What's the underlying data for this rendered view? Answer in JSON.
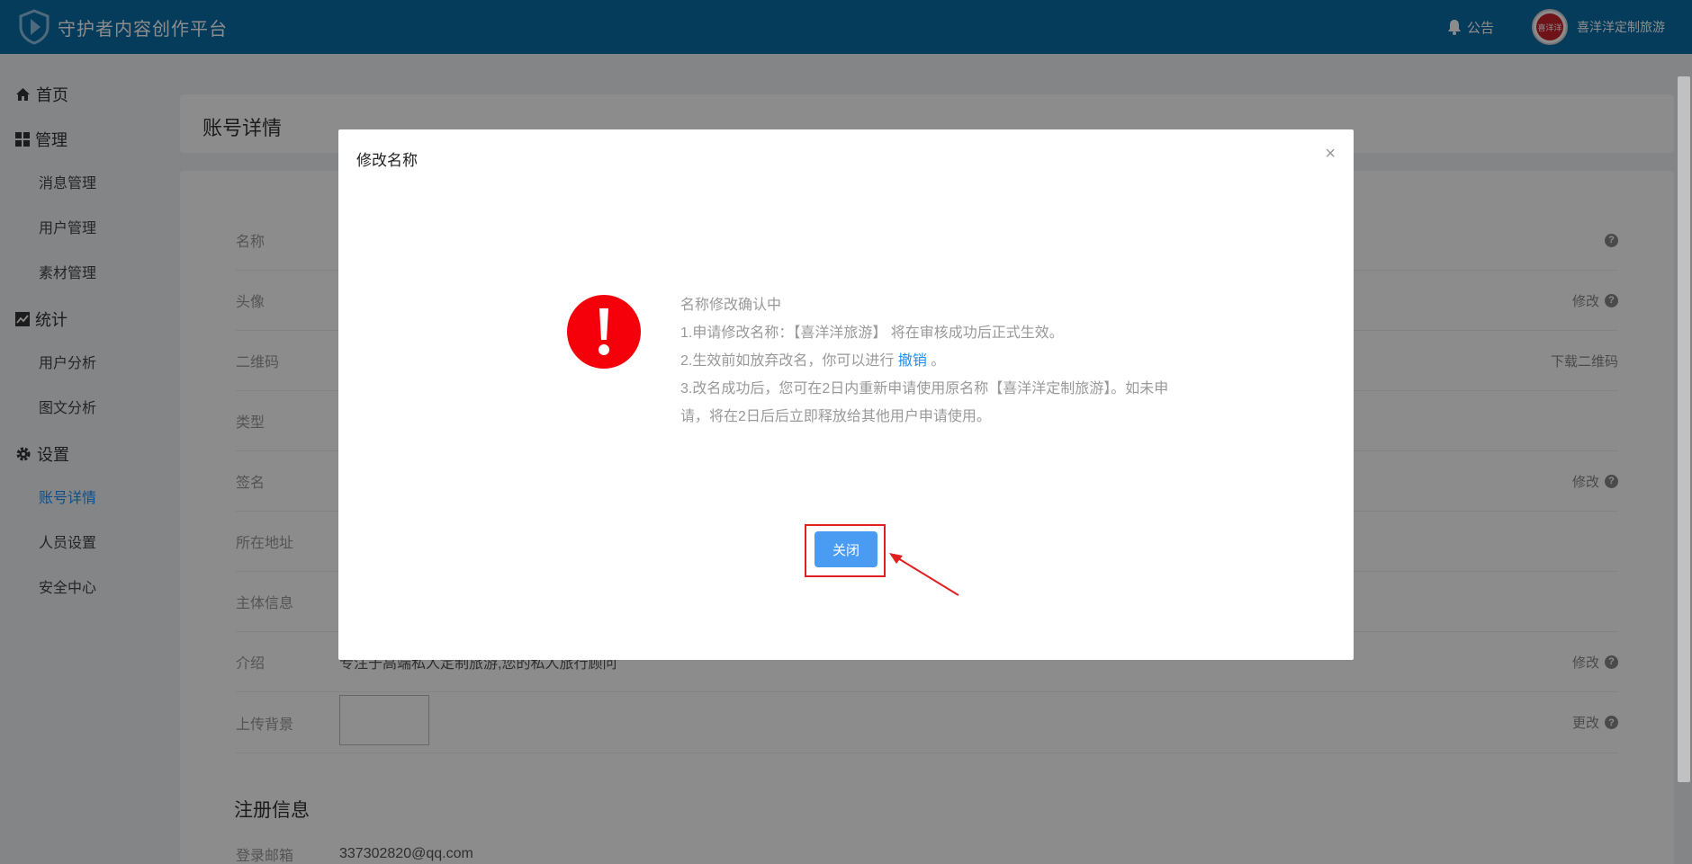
{
  "header": {
    "platform_name": "守护者内容创作平台",
    "notice_label": "公告",
    "avatar_text": "喜洋洋",
    "username": "喜洋洋定制旅游",
    "bg_color": "#0a6ea8"
  },
  "sidebar": {
    "home": "首页",
    "manage": "管理",
    "manage_items": [
      "消息管理",
      "用户管理",
      "素材管理"
    ],
    "stats": "统计",
    "stats_items": [
      "用户分析",
      "图文分析"
    ],
    "settings": "设置",
    "settings_items": [
      "账号详情",
      "人员设置",
      "安全中心"
    ],
    "active_item": "账号详情"
  },
  "page": {
    "title": "账号详情",
    "rows": [
      {
        "label": "名称",
        "value": "",
        "action": ""
      },
      {
        "label": "头像",
        "value": "",
        "action": "修改"
      },
      {
        "label": "二维码",
        "value": "",
        "action": "下载二维码"
      },
      {
        "label": "类型",
        "value": "",
        "action": ""
      },
      {
        "label": "签名",
        "value": "",
        "action": "修改"
      },
      {
        "label": "所在地址",
        "value": "",
        "action": ""
      },
      {
        "label": "主体信息",
        "value": "",
        "action": ""
      },
      {
        "label": "介绍",
        "value": "专注于高端私人定制旅游,您的私人旅行顾问",
        "action": "修改"
      },
      {
        "label": "上传背景",
        "value": "",
        "action": "更改"
      }
    ],
    "registration_title": "注册信息",
    "email_label": "登录邮箱",
    "email_value": "337302820@qq.com"
  },
  "modal": {
    "title": "修改名称",
    "close_symbol": "×",
    "status": "名称修改确认中",
    "line1": "1.申请修改名称：【喜洋洋旅游】 将在审核成功后正式生效。",
    "line2_prefix": "2.生效前如放弃改名，你可以进行",
    "line2_link": "撤销",
    "line2_suffix": "。",
    "line3": "3.改名成功后，您可在2日内重新申请使用原名称【喜洋洋定制旅游】。如未申请，将在2日后后立即释放给其他用户申请使用。",
    "close_button": "关闭",
    "alert_color": "#f5000a",
    "highlight_color": "#e02020"
  }
}
